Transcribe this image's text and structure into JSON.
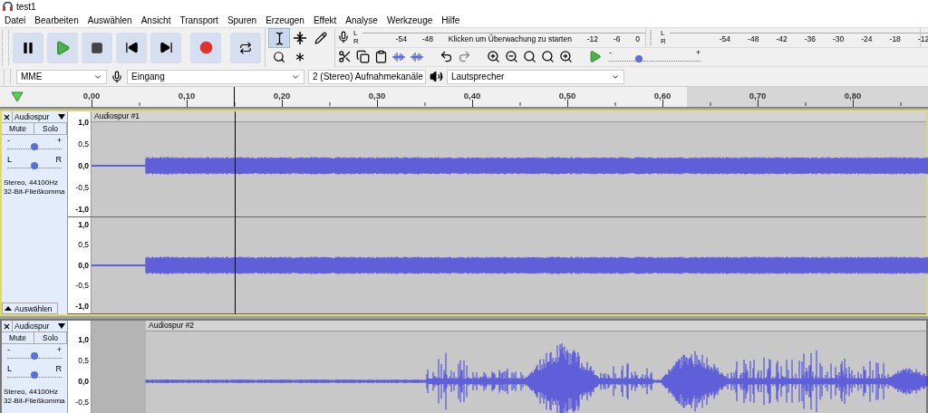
{
  "window": {
    "title": "test1"
  },
  "menu": [
    "Datei",
    "Bearbeiten",
    "Auswählen",
    "Ansicht",
    "Transport",
    "Spuren",
    "Erzeugen",
    "Effekt",
    "Analyse",
    "Werkzeuge",
    "Hilfe"
  ],
  "transport": [
    {
      "kind": "pause"
    },
    {
      "kind": "play"
    },
    {
      "kind": "stop"
    },
    {
      "kind": "skip_start"
    },
    {
      "kind": "skip_end"
    },
    {
      "kind": "record"
    },
    {
      "kind": "loop"
    }
  ],
  "tools": [
    {
      "kind": "select",
      "selected": true
    },
    {
      "kind": "envelope",
      "selected": false
    },
    {
      "kind": "draw",
      "selected": false
    },
    {
      "kind": "zoom",
      "selected": false
    },
    {
      "kind": "multi",
      "selected": false
    }
  ],
  "record_meter": {
    "channels": [
      "L",
      "R"
    ],
    "scale_before": [
      "-54",
      "-48"
    ],
    "hint": "Klicken um Überwachung zu starten",
    "scale_after": [
      "-12",
      "-6",
      "0"
    ]
  },
  "playback_meter": {
    "channels": [
      "L",
      "R"
    ],
    "scale": [
      "-54",
      "-48",
      "-42",
      "-36",
      "-30",
      "-24",
      "-18",
      "-12"
    ]
  },
  "edit_tools": [
    {
      "kind": "cut",
      "disabled": false
    },
    {
      "kind": "copy",
      "disabled": false
    },
    {
      "kind": "paste",
      "disabled": false
    },
    {
      "kind": "trim",
      "disabled": false
    },
    {
      "kind": "silence",
      "disabled": false
    },
    {
      "kind": "undo",
      "disabled": false
    },
    {
      "kind": "redo",
      "disabled": true
    },
    {
      "kind": "zoom_in",
      "disabled": false
    },
    {
      "kind": "zoom_out",
      "disabled": false
    },
    {
      "kind": "fit_selection",
      "disabled": false
    },
    {
      "kind": "fit_project",
      "disabled": false
    },
    {
      "kind": "zoom_toggle",
      "disabled": false
    },
    {
      "kind": "play_at_speed",
      "disabled": false
    }
  ],
  "play_speed": {
    "min_label": "-",
    "max_label": "+",
    "level": 0.33
  },
  "devices": {
    "host": "MME",
    "input": "Eingang",
    "channels": "2 (Stereo) Aufnahmekanäle",
    "output": "Lautsprecher"
  },
  "ruler": {
    "labels": [
      "0,00",
      "0,10",
      "0,20",
      "0,30",
      "0,40",
      "0,50",
      "0,60",
      "0,70",
      "0,80"
    ]
  },
  "tracks": [
    {
      "name": "Audiospur",
      "selected": true,
      "buttons": [
        "Mute",
        "Solo"
      ],
      "gain": {
        "min_label": "-",
        "max_label": "+",
        "level": 0.5
      },
      "pan": {
        "min_label": "L",
        "max_label": "R",
        "level": 0.5
      },
      "info": [
        "Stereo, 44100Hz",
        "32-Bit-Fließkomma"
      ],
      "select_button": "Auswählen",
      "clip": {
        "title": "Audiospur #1"
      },
      "channels": [
        {
          "scale": [
            "1,0",
            "0,5",
            "0,0",
            "-0,5",
            "-1,0"
          ]
        },
        {
          "scale": [
            "1,0",
            "0,5",
            "0,0",
            "-0,5",
            "-1,0"
          ]
        }
      ]
    },
    {
      "name": "Audiospur",
      "selected": false,
      "buttons": [
        "Mute",
        "Solo"
      ],
      "gain": {
        "min_label": "-",
        "max_label": "+",
        "level": 0.5
      },
      "pan": {
        "min_label": "L",
        "max_label": "R",
        "level": 0.5
      },
      "info": [
        "Stereo, 44100Hz",
        "32-Bit-Fließkomma"
      ],
      "clip": {
        "title": "Audiospur #2"
      },
      "channels": [
        {
          "scale": [
            "1,0",
            "0,5",
            "0,0",
            "-0,5"
          ]
        }
      ]
    }
  ]
}
